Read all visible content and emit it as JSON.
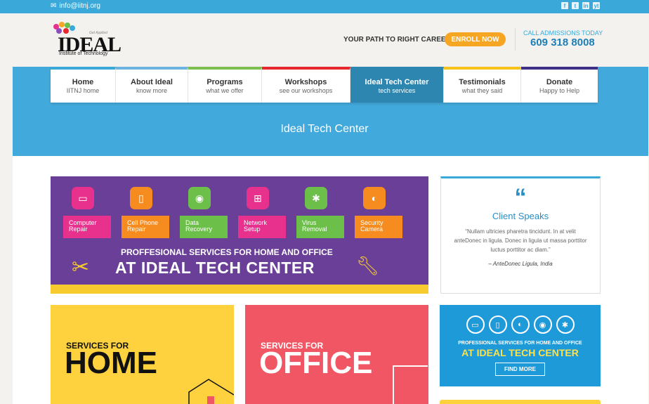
{
  "topbar": {
    "email": "info@iitnj.org",
    "social": [
      "f",
      "t",
      "in",
      "yt"
    ]
  },
  "header": {
    "logo_word": "IDEAL",
    "logo_tagline": "Institute of Technology",
    "logo_slogan": "Get Applied",
    "path_text": "YOUR PATH TO RIGHT CAREER",
    "enroll_label": "ENROLL NOW",
    "call_label": "CALL ADMISSIONS TODAY",
    "phone": "609 318 8008"
  },
  "nav": [
    {
      "main": "Home",
      "sub": "IITNJ home",
      "color": "#3aa9d9"
    },
    {
      "main": "About Ideal",
      "sub": "know more",
      "color": "#6db5e0"
    },
    {
      "main": "Programs",
      "sub": "what we offer",
      "color": "#7fbf4d"
    },
    {
      "main": "Workshops",
      "sub": "see our workshops",
      "color": "#e8262e"
    },
    {
      "main": "Ideal Tech Center",
      "sub": "tech services",
      "color": "#2c86b0"
    },
    {
      "main": "Testimonials",
      "sub": "what they said",
      "color": "#f6c21c"
    },
    {
      "main": "Donate",
      "sub": "Happy to Help",
      "color": "#3d2e86"
    }
  ],
  "hero": {
    "title": "Ideal Tech Center"
  },
  "banner": {
    "services": [
      {
        "label": "Computer Repair",
        "color": "#e8318d"
      },
      {
        "label": "Cell Phone Repair",
        "color": "#f68b1f"
      },
      {
        "label": "Data Recovery",
        "color": "#6cc04a"
      },
      {
        "label": "Network Setup",
        "color": "#e8318d"
      },
      {
        "label": "Virus Removal",
        "color": "#6cc04a"
      },
      {
        "label": "Security Camera",
        "color": "#f68b1f"
      }
    ],
    "subtitle": "PROFFESIONAL SERVICES FOR HOME AND OFFICE",
    "title": "AT IDEAL TECH CENTER"
  },
  "client": {
    "quote_mark": "“",
    "heading": "Client Speaks",
    "text": "“Nullam ultricies pharetra tincidunt. In at velit anteDonec in ligula. Donec in ligula ut massa porttitor luctus porttitor ac diam.”",
    "author": "– AnteDonec Ligula, India"
  },
  "home_block": {
    "a": "SERVICES FOR",
    "b": "HOME"
  },
  "office_block": {
    "a": "SERVICES FOR",
    "b": "OFFICE"
  },
  "promo": {
    "subtitle": "PROFESSIONAL SERVICES FOR HOME AND OFFICE",
    "title": "AT IDEAL TECH CENTER",
    "button": "FIND MORE"
  }
}
